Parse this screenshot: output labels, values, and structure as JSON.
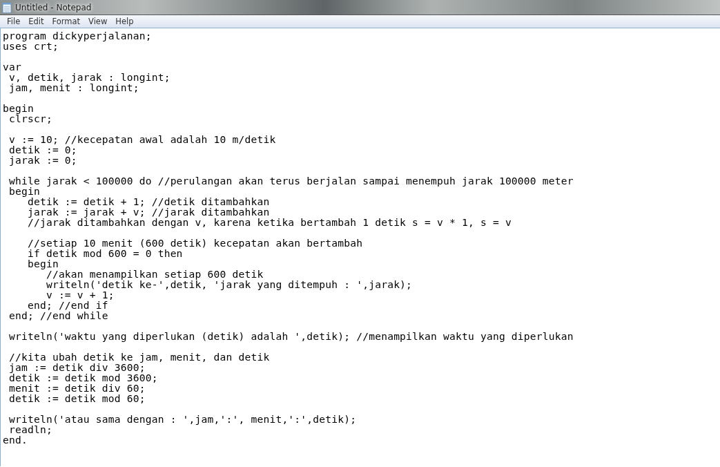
{
  "window": {
    "title": "Untitled - Notepad"
  },
  "menu": [
    "File",
    "Edit",
    "Format",
    "View",
    "Help"
  ],
  "editor": {
    "text": "program dickyperjalanan;\nuses crt;\n\nvar\n v, detik, jarak : longint;\n jam, menit : longint;\n\nbegin\n clrscr;\n\n v := 10; //kecepatan awal adalah 10 m/detik\n detik := 0;\n jarak := 0;\n\n while jarak < 100000 do //perulangan akan terus berjalan sampai menempuh jarak 100000 meter\n begin\n    detik := detik + 1; //detik ditambahkan\n    jarak := jarak + v; //jarak ditambahkan\n    //jarak ditambahkan dengan v, karena ketika bertambah 1 detik s = v * 1, s = v\n\n    //setiap 10 menit (600 detik) kecepatan akan bertambah\n    if detik mod 600 = 0 then\n    begin\n       //akan menampilkan setiap 600 detik\n       writeln('detik ke-',detik, 'jarak yang ditempuh : ',jarak);\n       v := v + 1;\n    end; //end if\n end; //end while\n\n writeln('waktu yang diperlukan (detik) adalah ',detik); //menampilkan waktu yang diperlukan\n\n //kita ubah detik ke jam, menit, dan detik\n jam := detik div 3600;\n detik := detik mod 3600;\n menit := detik div 60;\n detik := detik mod 60;\n\n writeln('atau sama dengan : ',jam,':', menit,':',detik);\n readln;\nend."
  }
}
